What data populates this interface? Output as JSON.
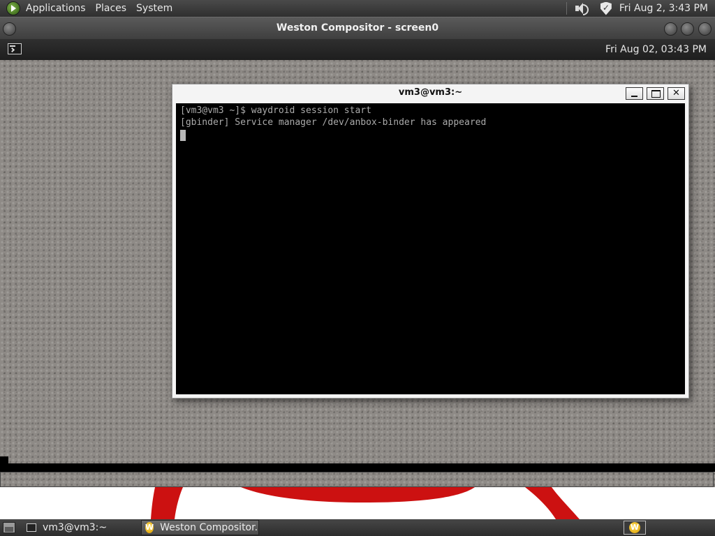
{
  "top_panel": {
    "menus": [
      "Applications",
      "Places",
      "System"
    ],
    "icons": [
      "applications-icon",
      "speaker-icon",
      "shield-icon"
    ],
    "clock": "Fri Aug  2,  3:43 PM"
  },
  "weston_window": {
    "title": "Weston Compositor - screen0",
    "panel_clock": "Fri Aug 02, 03:43 PM",
    "launcher_icon": "terminal-icon"
  },
  "terminal": {
    "title": "vm3@vm3:~",
    "lines": [
      "[vm3@vm3 ~]$ waydroid session start",
      "[gbinder] Service manager /dev/anbox-binder has appeared"
    ]
  },
  "taskbar": {
    "tasks": [
      {
        "label": "vm3@vm3:~",
        "icon": "terminal-icon",
        "active": false
      },
      {
        "label": "Weston Compositor...",
        "icon": "waydroid-icon",
        "active": true
      }
    ],
    "tray_icon": "waydroid-icon",
    "icon_letter": "W"
  },
  "colors": {
    "panel": "#3a3a3a",
    "accent_red": "#cc1111",
    "terminal_bg": "#000000",
    "terminal_fg": "#aaaaaa"
  }
}
